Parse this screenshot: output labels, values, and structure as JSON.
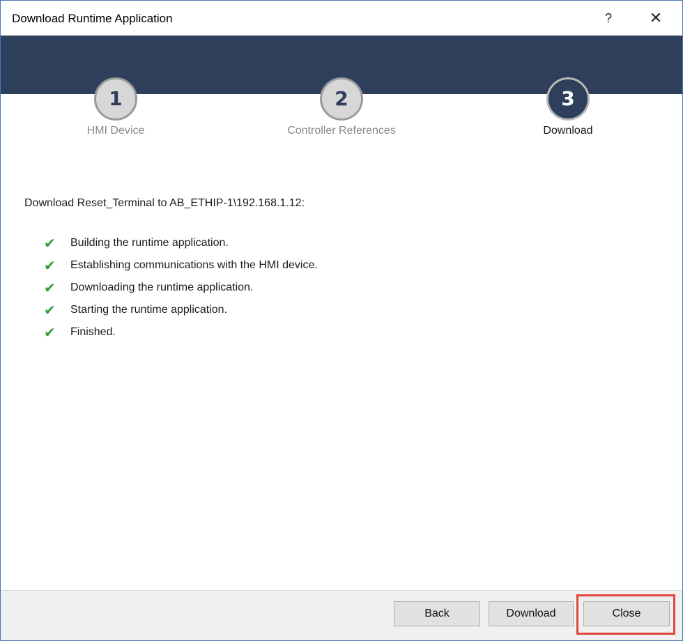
{
  "window": {
    "title": "Download Runtime Application",
    "help_label": "?",
    "close_label": "✕"
  },
  "wizard": {
    "steps": [
      {
        "number": "1",
        "label": "HMI Device",
        "state": "completed"
      },
      {
        "number": "2",
        "label": "Controller References",
        "state": "completed"
      },
      {
        "number": "3",
        "label": "Download",
        "state": "active"
      }
    ]
  },
  "content": {
    "destination_text": "Download Reset_Terminal to AB_ETHIP-1\\192.168.1.12:",
    "status_items": [
      {
        "icon": "check-icon",
        "text": "Building the runtime application."
      },
      {
        "icon": "check-icon",
        "text": "Establishing communications with the HMI device."
      },
      {
        "icon": "check-icon",
        "text": "Downloading the runtime application."
      },
      {
        "icon": "check-icon",
        "text": "Starting the runtime application."
      },
      {
        "icon": "check-icon",
        "text": "Finished."
      }
    ],
    "check_symbol": "✔"
  },
  "footer": {
    "back_label": "Back",
    "download_label": "Download",
    "close_label": "Close"
  },
  "colors": {
    "banner": "#2e3f5c",
    "check": "#2e9e3a",
    "highlight": "#e0453e",
    "active_step": "#2e3f5c",
    "inactive_step": "#d7d7d7"
  }
}
